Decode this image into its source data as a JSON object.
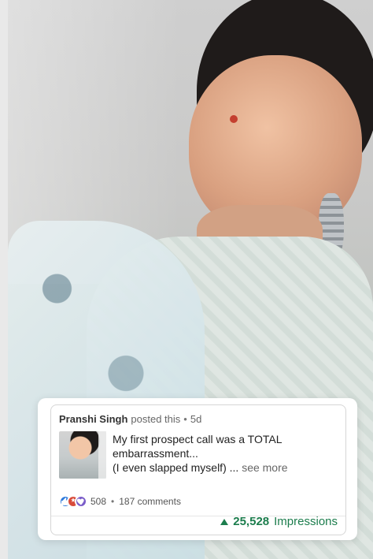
{
  "post": {
    "author": "Pranshi Singh",
    "posted_phrase": "posted this",
    "separator": "•",
    "age": "5d",
    "text_lines": [
      "My first prospect call was a TOTAL",
      "embarrassment...",
      "(I even slapped myself) ..."
    ],
    "see_more": "see more",
    "reactions_count": "508",
    "comments": "187 comments",
    "impressions_number": "25,528",
    "impressions_label": "Impressions"
  },
  "icons": {
    "reactions": [
      "like-icon",
      "celebrate-icon",
      "support-icon"
    ],
    "impressions": "up-triangle-icon"
  },
  "colors": {
    "impressions_green": "#1c7d4d",
    "text_dark": "#222222",
    "muted": "#666666",
    "card_border": "#d6d6d6"
  }
}
